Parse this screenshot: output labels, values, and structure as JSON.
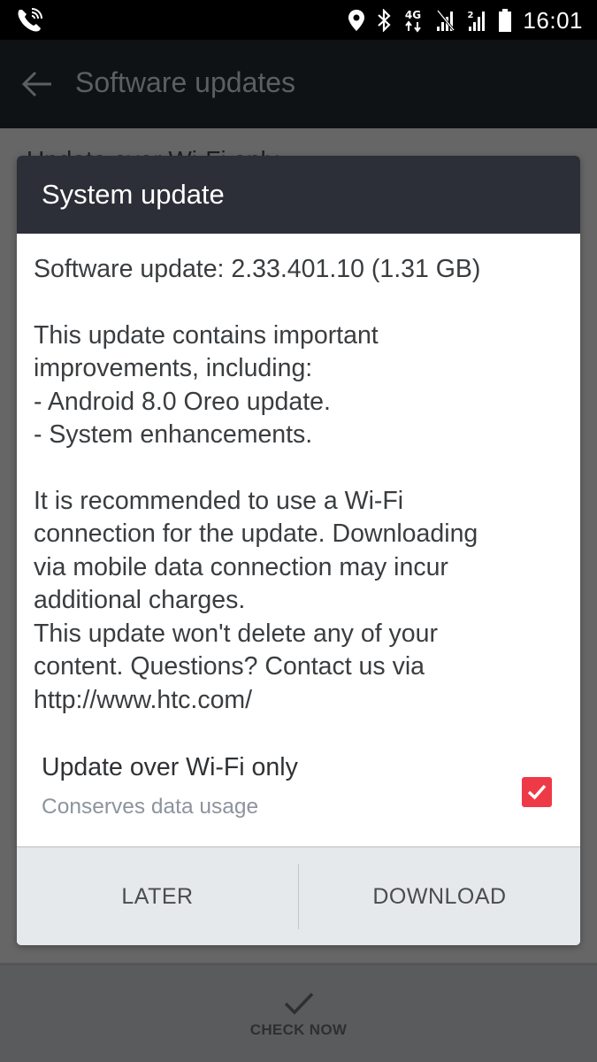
{
  "status_bar": {
    "time": "16:01",
    "icons": [
      "wifi-calling-icon",
      "location-icon",
      "bluetooth-icon",
      "4g-data-icon",
      "signal-sim1-icon",
      "signal-sim2-icon",
      "battery-icon"
    ],
    "network_label": "4G",
    "sim2_label": "2"
  },
  "app_bar": {
    "title": "Software updates",
    "back_icon": "arrow-left-icon"
  },
  "background": {
    "preference_title": "Update over Wi-Fi only"
  },
  "bottom_bar": {
    "check_now_label": "CHECK NOW",
    "check_icon": "checkmark-icon"
  },
  "dialog": {
    "title": "System update",
    "version_line": "Software update: 2.33.401.10 (1.31 GB)",
    "description": "This update contains important\nimprovements, including:\n- Android 8.0 Oreo update.\n- System enhancements.",
    "notice": "It is recommended to use a Wi-Fi\nconnection for the update. Downloading\nvia mobile data connection may incur\nadditional charges.\nThis update won't delete any of your\ncontent. Questions? Contact us via\nhttp://www.htc.com/",
    "preference": {
      "title": "Update over Wi-Fi only",
      "subtitle": "Conserves data usage",
      "checked": true
    },
    "buttons": {
      "later": "LATER",
      "download": "DOWNLOAD"
    },
    "colors": {
      "header": "#2c2f37",
      "checkbox": "#ee3a47",
      "footer": "#e6e9eb"
    }
  }
}
